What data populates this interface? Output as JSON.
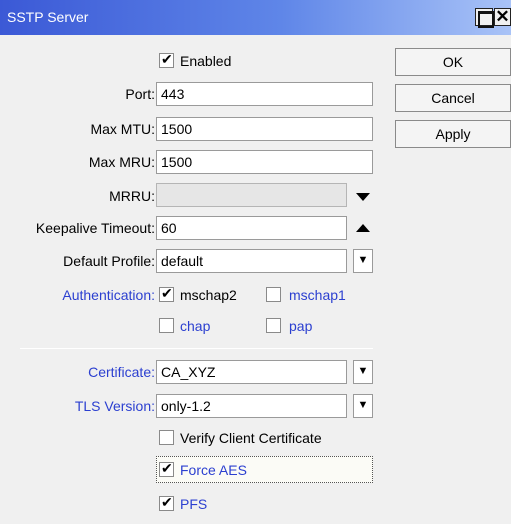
{
  "window": {
    "title": "SSTP Server",
    "maximize_icon": "maximize-icon",
    "close_glyph": "✕"
  },
  "enabled": {
    "label": "Enabled",
    "checked": true
  },
  "fields": {
    "port": {
      "label": "Port:",
      "value": "443"
    },
    "max_mtu": {
      "label": "Max MTU:",
      "value": "1500"
    },
    "max_mru": {
      "label": "Max MRU:",
      "value": "1500"
    },
    "mrru": {
      "label": "MRRU:",
      "value": ""
    },
    "keepalive": {
      "label": "Keepalive Timeout:",
      "value": "60"
    },
    "default_profile": {
      "label": "Default Profile:",
      "value": "default"
    }
  },
  "authentication": {
    "label": "Authentication:",
    "options": [
      {
        "label": "mschap2",
        "checked": true
      },
      {
        "label": "mschap1",
        "checked": false
      },
      {
        "label": "chap",
        "checked": false
      },
      {
        "label": "pap",
        "checked": false
      }
    ]
  },
  "certificate": {
    "label": "Certificate:",
    "value": "CA_XYZ"
  },
  "tls_version": {
    "label": "TLS Version:",
    "value": "only-1.2"
  },
  "verify_client": {
    "label": "Verify Client Certificate",
    "checked": false
  },
  "force_aes": {
    "label": "Force AES",
    "checked": true
  },
  "pfs": {
    "label": "PFS",
    "checked": true
  },
  "buttons": {
    "ok": "OK",
    "cancel": "Cancel",
    "apply": "Apply"
  },
  "colors": {
    "titlebar_start": "#3b59d6",
    "titlebar_end": "#a9c3f7",
    "blue_label": "#2b3fd0",
    "background": "#f0f0f0"
  }
}
